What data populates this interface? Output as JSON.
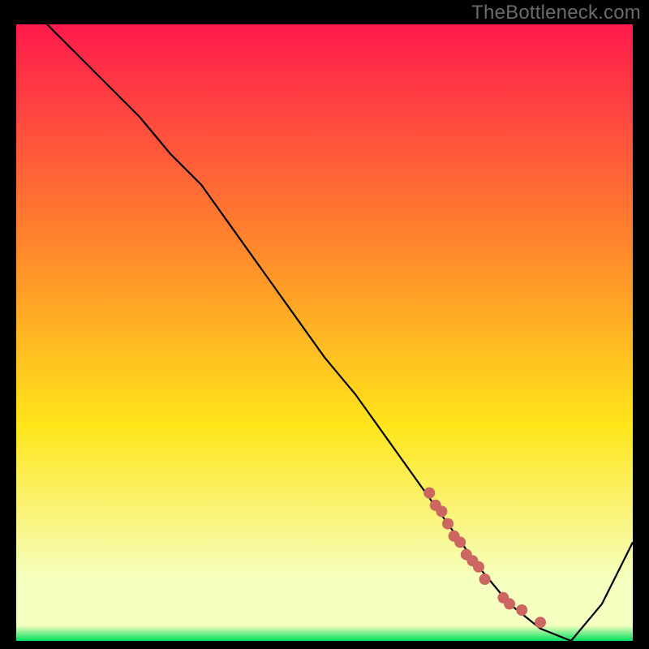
{
  "watermark": "TheBottleneck.com",
  "colors": {
    "frame_bg": "#000000",
    "curve_stroke": "#000000",
    "marker_fill": "#cc6660",
    "gradient_top": "#ff1a4d",
    "gradient_mid1": "#ff8a2b",
    "gradient_mid2": "#ffe51a",
    "gradient_mid3": "#f5ffbf",
    "gradient_bottom": "#00e060"
  },
  "chart_data": {
    "type": "line",
    "title": "",
    "xlabel": "",
    "ylabel": "",
    "xlim": [
      0,
      100
    ],
    "ylim": [
      0,
      100
    ],
    "x": [
      0,
      5,
      10,
      15,
      20,
      25,
      30,
      35,
      40,
      45,
      50,
      55,
      60,
      65,
      70,
      75,
      80,
      85,
      90,
      95,
      100
    ],
    "values": [
      104,
      100,
      95,
      90,
      85,
      79,
      74,
      67,
      60,
      53,
      46,
      40,
      33,
      26,
      19,
      12,
      6,
      2,
      0,
      6,
      16
    ],
    "markers": {
      "x": [
        67,
        68,
        69,
        70,
        71,
        72,
        73,
        74,
        75,
        76,
        79,
        80,
        82,
        85
      ],
      "y": [
        24,
        22,
        21,
        19,
        17,
        16,
        14,
        13,
        12,
        10,
        7,
        6,
        5,
        3
      ]
    }
  }
}
